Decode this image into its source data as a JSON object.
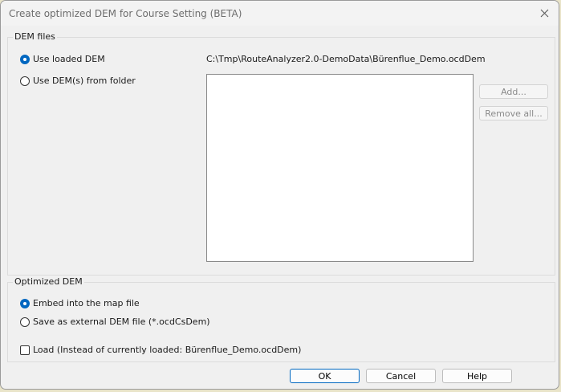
{
  "window": {
    "title": "Create optimized DEM for Course Setting (BETA)"
  },
  "dem_files": {
    "legend": "DEM files",
    "option_loaded": "Use loaded DEM",
    "option_folder": "Use DEM(s) from folder",
    "loaded_path": "C:\\Tmp\\RouteAnalyzer2.0-DemoData\\Bürenflue_Demo.ocdDem",
    "add_label": "Add...",
    "remove_all_label": "Remove all..."
  },
  "optimized_dem": {
    "legend": "Optimized DEM",
    "option_embed": "Embed into the map file",
    "option_external": "Save as external DEM file (*.ocdCsDem)",
    "load_checkbox": "Load (Instead of currently loaded: Bürenflue_Demo.ocdDem)"
  },
  "footer": {
    "ok_label": "OK",
    "cancel_label": "Cancel",
    "help_label": "Help"
  },
  "colors": {
    "accent": "#0067c0",
    "background": "#f0f0f0"
  }
}
